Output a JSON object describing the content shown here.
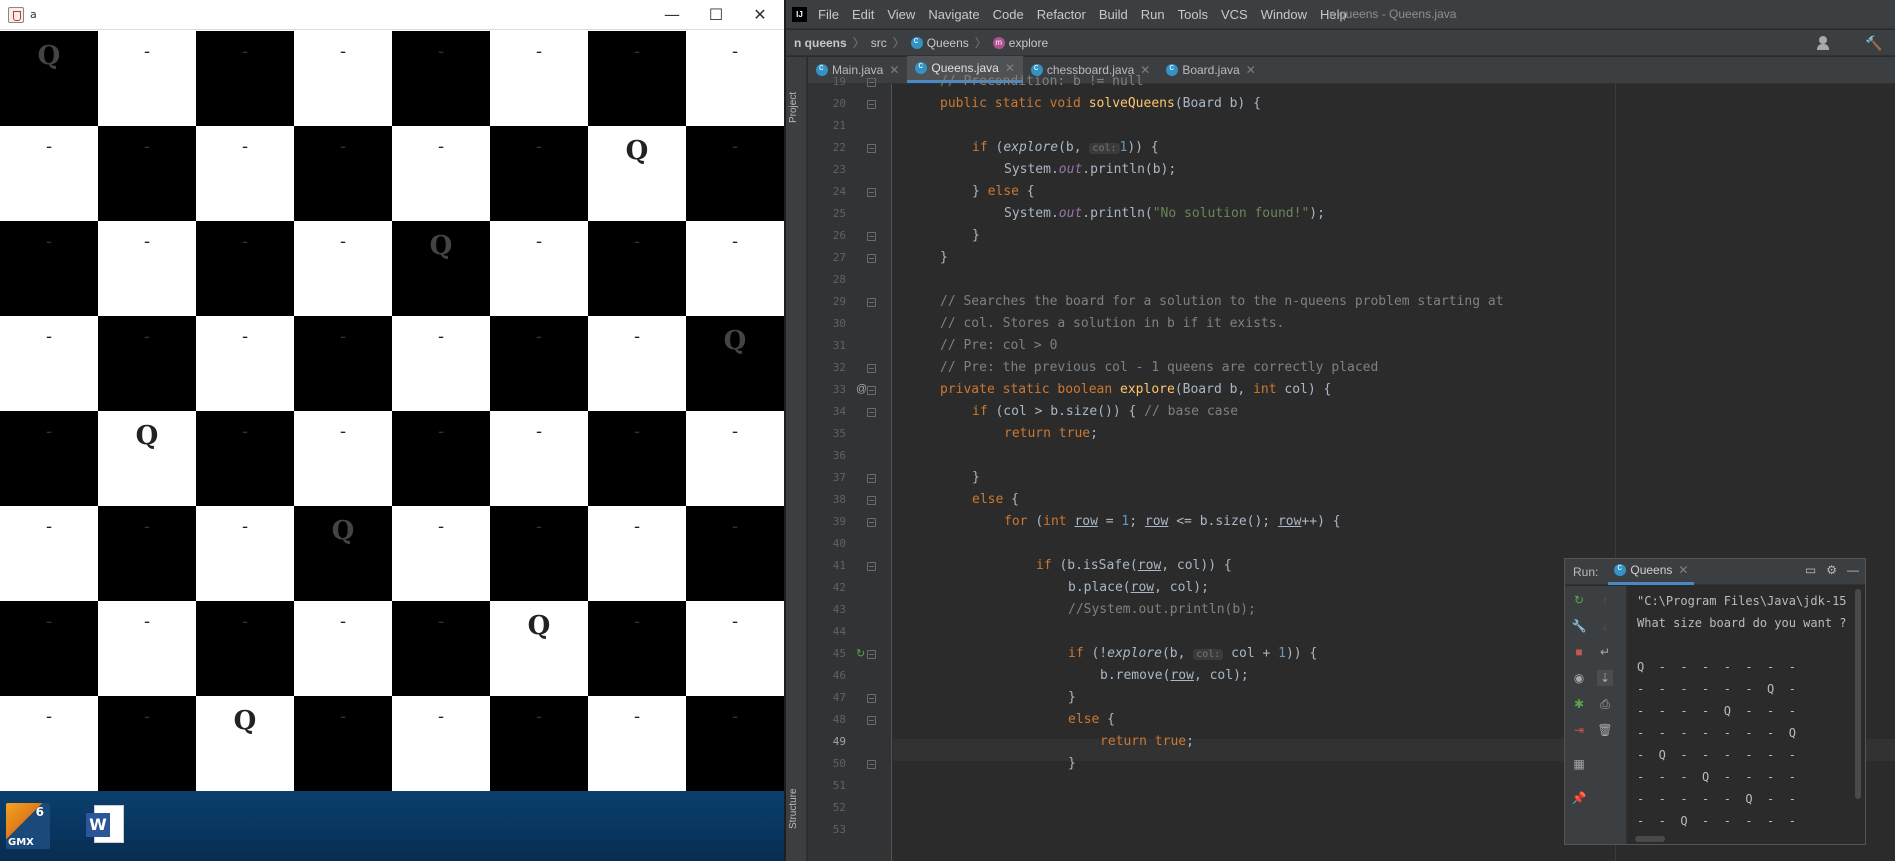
{
  "board_window": {
    "title": "a",
    "min_glyph": "—",
    "max_glyph": "☐",
    "close_glyph": "✕",
    "rows": [
      [
        "Q",
        "-",
        "-",
        "-",
        "-",
        "-",
        "-",
        "-"
      ],
      [
        "-",
        "-",
        "-",
        "-",
        "-",
        "-",
        "Q",
        "-"
      ],
      [
        "-",
        "-",
        "-",
        "-",
        "Q",
        "-",
        "-",
        "-"
      ],
      [
        "-",
        "-",
        "-",
        "-",
        "-",
        "-",
        "-",
        "Q"
      ],
      [
        "-",
        "Q",
        "-",
        "-",
        "-",
        "-",
        "-",
        "-"
      ],
      [
        "-",
        "-",
        "-",
        "Q",
        "-",
        "-",
        "-",
        "-"
      ],
      [
        "-",
        "-",
        "-",
        "-",
        "-",
        "Q",
        "-",
        "-"
      ],
      [
        "-",
        "-",
        "Q",
        "-",
        "-",
        "-",
        "-",
        "-"
      ]
    ]
  },
  "taskbar": {
    "gmx_label": "GMX",
    "gmx_number": "6",
    "word_letter": "W"
  },
  "ide": {
    "logo": "IJ",
    "menu": [
      "File",
      "Edit",
      "View",
      "Navigate",
      "Code",
      "Refactor",
      "Build",
      "Run",
      "Tools",
      "VCS",
      "Window",
      "Help"
    ],
    "window_title": "n queens - Queens.java",
    "breadcrumb": {
      "project": "n queens",
      "src": "src",
      "cls": "Queens",
      "method_icon": "m",
      "method": "explore"
    },
    "project_label": "Project",
    "structure_label": "Structure",
    "tabs": [
      {
        "label": "Main.java",
        "active": false
      },
      {
        "label": "Queens.java",
        "active": true
      },
      {
        "label": "chessboard.java",
        "active": false
      },
      {
        "label": "Board.java",
        "active": false
      }
    ],
    "line_numbers": [
      "19",
      "20",
      "21",
      "22",
      "23",
      "24",
      "25",
      "26",
      "27",
      "28",
      "29",
      "30",
      "31",
      "32",
      "33",
      "34",
      "35",
      "36",
      "37",
      "38",
      "39",
      "40",
      "41",
      "42",
      "43",
      "44",
      "45",
      "46",
      "47",
      "48",
      "49",
      "50",
      "51",
      "52",
      "53"
    ],
    "current_line": "49",
    "gutter_at": "@",
    "gutter_run": "↻",
    "code": {
      "l19": "// Precondition: b != null",
      "l20_kw": "public static void ",
      "l20_fn": "solveQueens",
      "l20_rest": "(Board b) {",
      "l22_kw": "if ",
      "l22_a": "(",
      "l22_fn": "explore",
      "l22_b": "(b, ",
      "l22_hint": "col:",
      "l22_num": "1",
      "l22_c": ")) {",
      "l23_a": "System.",
      "l23_out": "out",
      "l23_b": ".println(b);",
      "l24_a": "} ",
      "l24_kw": "else",
      "l24_b": " {",
      "l25_a": "System.",
      "l25_out": "out",
      "l25_b": ".println(",
      "l25_str": "\"No solution found!\"",
      "l25_c": ");",
      "l26": "}",
      "l27": "}",
      "l29": "// Searches the board for a solution to the n-queens problem starting at",
      "l30": "// col. Stores a solution in b if it exists.",
      "l31": "// Pre: col > 0",
      "l32": "// Pre: the previous col - 1 queens are correctly placed",
      "l33_kw": "private static boolean ",
      "l33_fn": "explore",
      "l33_a": "(Board b, ",
      "l33_kw2": "int",
      "l33_b": " col) {",
      "l34_kw": "if ",
      "l34_a": "(col > b.size()) { ",
      "l34_cmt": "// base case",
      "l35_kw": "return true",
      "l35_a": ";",
      "l37": "}",
      "l38_kw": "else",
      "l38_a": " {",
      "l39_kw": "for ",
      "l39_a": "(",
      "l39_kw2": "int ",
      "l39_row1": "row",
      "l39_b": " = ",
      "l39_num": "1",
      "l39_c": "; ",
      "l39_row2": "row",
      "l39_d": " <= b.size(); ",
      "l39_row3": "row",
      "l39_e": "++) {",
      "l41_kw": "if ",
      "l41_a": "(b.isSafe(",
      "l41_row": "row",
      "l41_b": ", col)) {",
      "l42_a": "b.place(",
      "l42_row": "row",
      "l42_b": ", col);",
      "l43": "//System.out.println(b);",
      "l45_kw": "if ",
      "l45_a": "(!",
      "l45_fn": "explore",
      "l45_b": "(b, ",
      "l45_hint": "col:",
      "l45_c": " col + ",
      "l45_num": "1",
      "l45_d": ")) {",
      "l46_a": "b.remove(",
      "l46_row": "row",
      "l46_b": ", col);",
      "l47": "}",
      "l48_kw": "else",
      "l48_a": " {",
      "l49_kw": "return true",
      "l49_a": ";",
      "l50": "}"
    },
    "run_panel": {
      "label": "Run:",
      "tab": "Queens",
      "output": [
        "\"C:\\Program Files\\Java\\jdk-15",
        "What size board do you want ?",
        "",
        "Q  -  -  -  -  -  -  -",
        "-  -  -  -  -  -  Q  -",
        "-  -  -  -  Q  -  -  -",
        "-  -  -  -  -  -  -  Q",
        "-  Q  -  -  -  -  -  -",
        "-  -  -  Q  -  -  -  -",
        "-  -  -  -  -  Q  -  -",
        "-  -  Q  -  -  -  -  -"
      ]
    }
  }
}
